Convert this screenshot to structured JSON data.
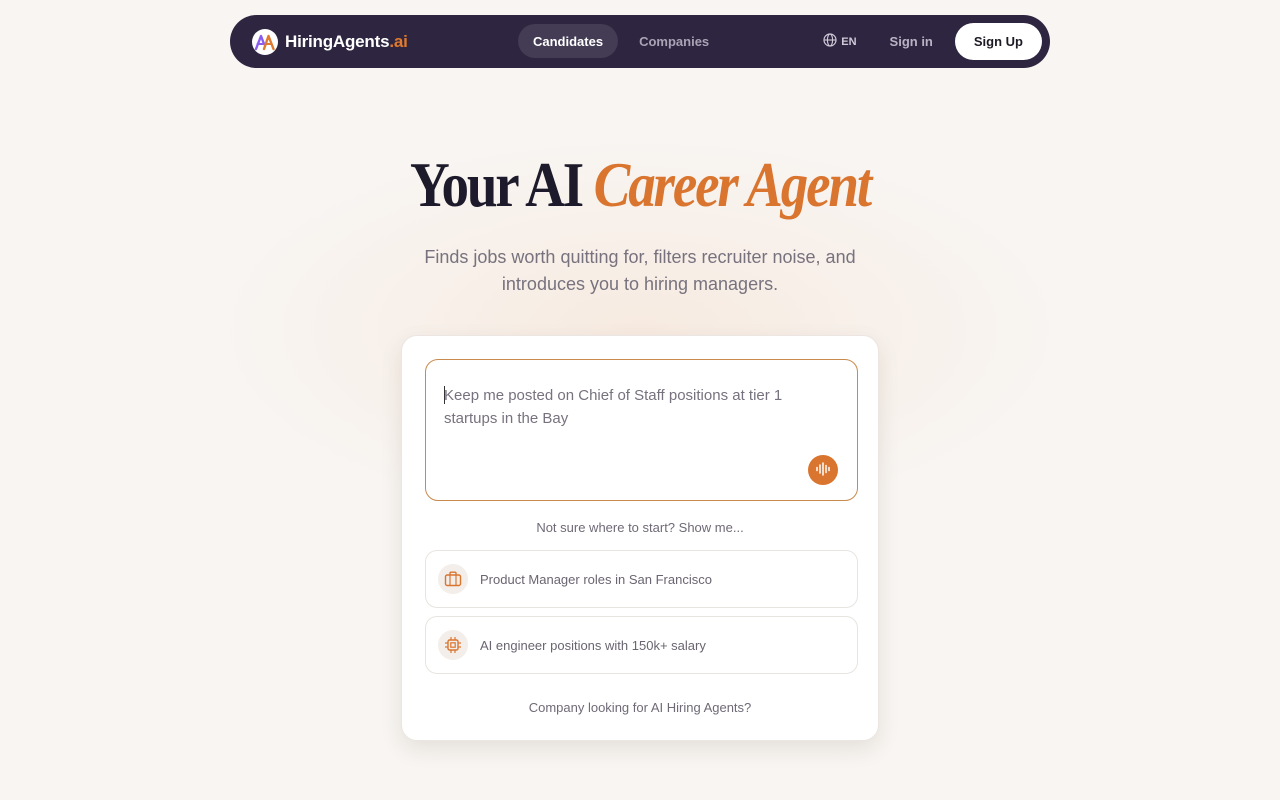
{
  "colors": {
    "nav_bg": "#2e2540",
    "accent": "#d9752f",
    "page_bg": "#f8f5f2"
  },
  "nav": {
    "brand": {
      "name": "HiringAgents",
      "suffix": ".ai",
      "logo_icon": "ha-logo-icon"
    },
    "tabs": [
      {
        "label": "Candidates",
        "active": true
      },
      {
        "label": "Companies",
        "active": false
      }
    ],
    "language": {
      "icon": "globe-icon",
      "label": "EN"
    },
    "signin_label": "Sign in",
    "signup_label": "Sign Up"
  },
  "hero": {
    "title_plain": "Your AI",
    "title_accent": "Career Agent",
    "subtitle": "Finds jobs worth quitting for, filters recruiter noise, and introduces you to hiring managers."
  },
  "search": {
    "placeholder": "Keep me posted on Chief of Staff positions at tier 1 startups in the Bay",
    "voice_icon": "waveform-icon"
  },
  "helper_text": "Not sure where to start? Show me...",
  "suggestions": [
    {
      "icon": "briefcase-icon",
      "label": "Product Manager roles in San Francisco"
    },
    {
      "icon": "chip-icon",
      "label": "AI engineer positions with 150k+ salary"
    }
  ],
  "company_link": "Company looking for AI Hiring Agents?"
}
